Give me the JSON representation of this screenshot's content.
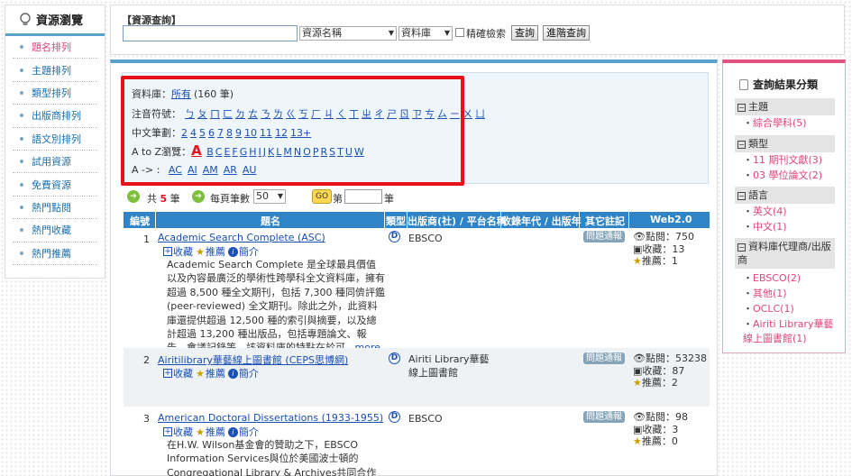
{
  "sidebar": {
    "title": "資源瀏覽",
    "items": [
      "題名排列",
      "主題排列",
      "類型排列",
      "出版商排列",
      "語文別排列",
      "試用資源",
      "免費資源",
      "熱門點閱",
      "熱門收藏",
      "熱門推薦"
    ]
  },
  "search": {
    "title": "【資源查詢】",
    "field_select": "資源名稱",
    "type_select": "資料庫",
    "exact_label": "精確檢索",
    "search_button": "查詢",
    "advanced_button": "進階查詢"
  },
  "filter": {
    "db_label": "資料庫：",
    "db_link": "所有",
    "db_count": "(160 筆)",
    "zhuyin_label": "注音符號：",
    "zhuyin": [
      "ㄅ",
      "ㄆ",
      "ㄇ",
      "ㄈ",
      "ㄉ",
      "ㄊ",
      "ㄋ",
      "ㄌ",
      "ㄍ",
      "ㄎ",
      "ㄏ",
      "ㄐ",
      "ㄑ",
      "ㄒ",
      "ㄓ",
      "ㄔ",
      "ㄕ",
      "ㄖ",
      "ㄗ",
      "ㄘ",
      "ㄙ",
      "ㄧ",
      "ㄨ",
      "ㄩ"
    ],
    "strokes_label": "中文筆劃：",
    "strokes": [
      "2",
      "4",
      "5",
      "6",
      "7",
      "8",
      "9",
      "10",
      "11",
      "12",
      "13+"
    ],
    "az_label": "A to Z瀏覽：",
    "az_current": "A",
    "az": [
      "B",
      "C",
      "E",
      "F",
      "G",
      "H",
      "I",
      "J",
      "K",
      "L",
      "M",
      "N",
      "O",
      "P",
      "R",
      "S",
      "T",
      "U",
      "W"
    ],
    "a_label": "A -> :",
    "a_sub": [
      "AC",
      "AI",
      "AM",
      "AR",
      "AU"
    ]
  },
  "pager": {
    "total_prefix": "共",
    "total": "5",
    "total_suffix": "筆",
    "per_page_label": "每頁筆數",
    "per_page": "50",
    "go": "GO",
    "page_prefix": "第",
    "page_suffix": "筆"
  },
  "table": {
    "headers": [
      "編號",
      "題名",
      "類型",
      "出版商(社) / 平台名稱",
      "收錄年代 / 出版年",
      "其它註記",
      "Web2.0"
    ],
    "actions": {
      "collect": "收藏",
      "recommend": "推薦",
      "intro": "簡介"
    },
    "badge": "問題通報",
    "stat_labels": {
      "views": "點閱：",
      "collect": "收藏：",
      "recommend": "推薦："
    },
    "rows": [
      {
        "num": "1",
        "title": "Academic Search Complete (ASC)",
        "desc": "Academic Search Complete 是全球最具價值以及內容最廣泛的學術性跨學科全文資料庫，擁有超過 8,500 種全文期刊，包括 7,300 種同儕評鑑 (peer-reviewed) 全文期刊。除此之外，此資料庫還提供超過 12,500 種的索引與摘要，以及總計超過 13,200 種出版品，包括專題論文、報告、會議記錄等。該資料庫的特點在於可...",
        "more": "more",
        "publisher": "EBSCO",
        "views": "750",
        "collect": "13",
        "recommend": "1"
      },
      {
        "num": "2",
        "title": "Airitilibrary華藝線上圖書館 (CEPS思博網)",
        "desc": "",
        "more": "",
        "publisher": "Airiti Library華藝線上圖書館",
        "views": "53238",
        "collect": "87",
        "recommend": "2"
      },
      {
        "num": "3",
        "title": "American Doctoral Dissertations (1933-1955)",
        "desc": "在H.W. Wilson基金會的贊助之下，EBSCO Information Services與位於美國波士頓的Congregational Library & Archives共同合作將原",
        "more": "",
        "publisher": "EBSCO",
        "views": "98",
        "collect": "3",
        "recommend": "0"
      }
    ]
  },
  "facets": {
    "title": "查詢結果分類",
    "groups": [
      {
        "name": "主題",
        "items": [
          "綜合學科(5)"
        ]
      },
      {
        "name": "類型",
        "items": [
          "11 期刊文獻(3)",
          "03 學位論文(2)"
        ]
      },
      {
        "name": "語言",
        "items": [
          "英文(4)",
          "中文(1)"
        ]
      },
      {
        "name": "資料庫代理商/出版商",
        "items": [
          "EBSCO(2)",
          "其他(1)",
          "OCLC(1)",
          "Airiti Library華藝線上圖書館(1)"
        ]
      }
    ]
  },
  "colors": {
    "accent": "#2e84c7",
    "highlight": "#e5121c",
    "facet": "#e2547f"
  }
}
